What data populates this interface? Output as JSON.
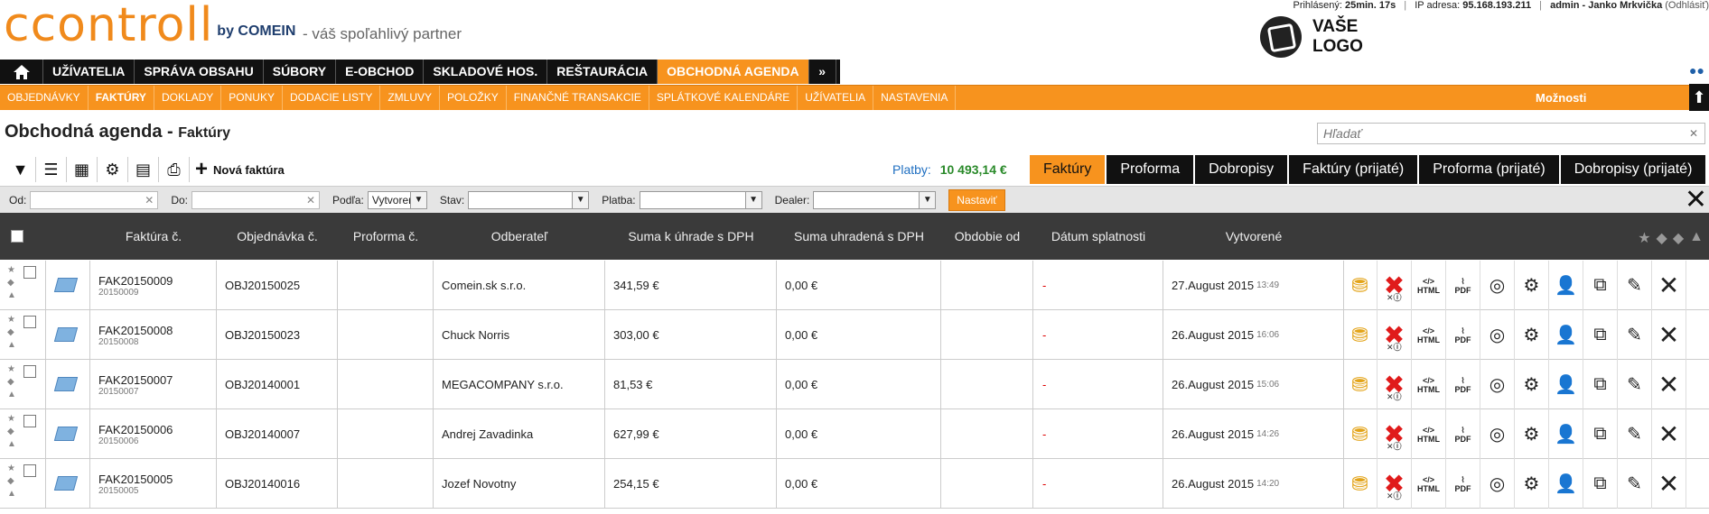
{
  "header": {
    "logo_text": "ccontroll",
    "logo_by": "by COMEIN",
    "slogan": "- váš spoľahlivý partner",
    "logged_label": "Prihlásený:",
    "logged_time": "25min. 17s",
    "ip_label": "IP adresa:",
    "ip_value": "95.168.193.211",
    "user": "admin - Janko Mrkvička",
    "logout": "(Odhlásiť)",
    "your_logo_line1": "VAŠE",
    "your_logo_line2": "LOGO"
  },
  "mainmenu": [
    "UŽÍVATELIA",
    "SPRÁVA OBSAHU",
    "SÚBORY",
    "E-OBCHOD",
    "SKLADOVÉ HOS.",
    "REŠTAURÁCIA",
    "OBCHODNÁ AGENDA",
    "»"
  ],
  "submenu": [
    "OBJEDNÁVKY",
    "FAKTÚRY",
    "DOKLADY",
    "PONUKY",
    "DODACIE LISTY",
    "ZMLUVY",
    "POLOŽKY",
    "FINANČNÉ TRANSAKCIE",
    "SPLÁTKOVÉ KALENDÁRE",
    "UŽÍVATELIA",
    "NASTAVENIA"
  ],
  "options_label": "Možnosti",
  "page": {
    "title": "Obchodná agenda -",
    "subtitle": "Faktúry",
    "search_placeholder": "Hľadať"
  },
  "toolbar": {
    "new_label": "Nová faktúra"
  },
  "payments": {
    "label": "Platby:",
    "value": "10 493,14 €"
  },
  "tabs": [
    "Faktúry",
    "Proforma",
    "Dobropisy",
    "Faktúry (prijaté)",
    "Proforma (prijaté)",
    "Dobropisy (prijaté)"
  ],
  "filters": {
    "from": "Od:",
    "to": "Do:",
    "by": "Podľa:",
    "by_value": "Vytvorené",
    "state": "Stav:",
    "payment": "Platba:",
    "dealer": "Dealer:",
    "apply": "Nastaviť"
  },
  "columns": [
    "Faktúra č.",
    "Objednávka č.",
    "Proforma č.",
    "Odberateľ",
    "Suma k úhrade s DPH",
    "Suma uhradená s DPH",
    "Obdobie od",
    "Dátum splatnosti",
    "Vytvorené"
  ],
  "rows": [
    {
      "invoice": "FAK20150009",
      "invoice_sub": "20150009",
      "order": "OBJ20150025",
      "proforma": "",
      "customer": "Comein.sk s.r.o.",
      "due": "341,59 €",
      "paid": "0,00 €",
      "period": "",
      "maturity": "-",
      "created": "27.August 2015",
      "time": "13:49"
    },
    {
      "invoice": "FAK20150008",
      "invoice_sub": "20150008",
      "order": "OBJ20150023",
      "proforma": "",
      "customer": "Chuck Norris",
      "due": "303,00 €",
      "paid": "0,00 €",
      "period": "",
      "maturity": "-",
      "created": "26.August 2015",
      "time": "16:06"
    },
    {
      "invoice": "FAK20150007",
      "invoice_sub": "20150007",
      "order": "OBJ20140001",
      "proforma": "",
      "customer": "MEGACOMPANY s.r.o.",
      "due": "81,53 €",
      "paid": "0,00 €",
      "period": "",
      "maturity": "-",
      "created": "26.August 2015",
      "time": "15:06"
    },
    {
      "invoice": "FAK20150006",
      "invoice_sub": "20150006",
      "order": "OBJ20140007",
      "proforma": "",
      "customer": "Andrej Zavadinka",
      "due": "627,99 €",
      "paid": "0,00 €",
      "period": "",
      "maturity": "-",
      "created": "26.August 2015",
      "time": "14:26"
    },
    {
      "invoice": "FAK20150005",
      "invoice_sub": "20150005",
      "order": "OBJ20140016",
      "proforma": "",
      "customer": "Jozef Novotny",
      "due": "254,15 €",
      "paid": "0,00 €",
      "period": "",
      "maturity": "-",
      "created": "26.August 2015",
      "time": "14:20"
    }
  ]
}
